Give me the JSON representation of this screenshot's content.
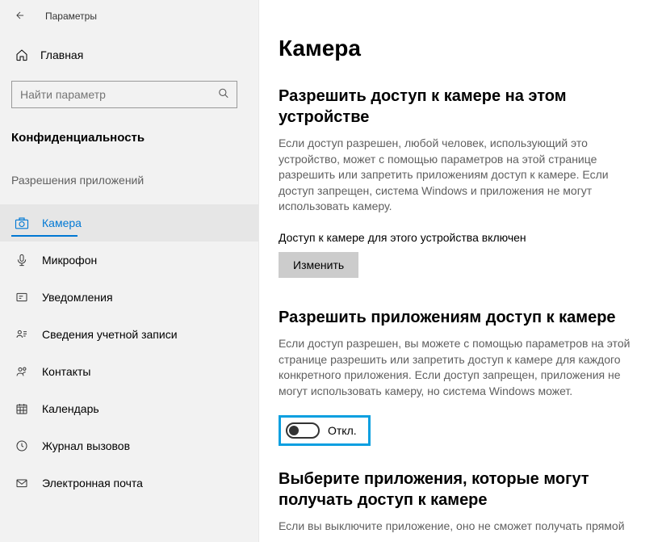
{
  "titlebar": {
    "label": "Параметры"
  },
  "home": {
    "label": "Главная"
  },
  "search": {
    "placeholder": "Найти параметр"
  },
  "group": {
    "title": "Конфиденциальность"
  },
  "subgroup": {
    "title": "Разрешения приложений"
  },
  "nav": {
    "items": [
      {
        "label": "Камера"
      },
      {
        "label": "Микрофон"
      },
      {
        "label": "Уведомления"
      },
      {
        "label": "Сведения учетной записи"
      },
      {
        "label": "Контакты"
      },
      {
        "label": "Календарь"
      },
      {
        "label": "Журнал вызовов"
      },
      {
        "label": "Электронная почта"
      }
    ]
  },
  "page": {
    "title": "Камера"
  },
  "section1": {
    "title": "Разрешить доступ к камере на этом устройстве",
    "desc": "Если доступ разрешен, любой человек, использующий это устройство, может с помощью параметров на этой странице разрешить или запретить приложениям доступ к камере. Если доступ запрещен, система Windows и приложения не могут использовать камеру.",
    "status": "Доступ к камере для этого устройства включен",
    "button": "Изменить"
  },
  "section2": {
    "title": "Разрешить приложениям доступ к камере",
    "desc": "Если доступ разрешен, вы можете с помощью параметров на этой странице разрешить или запретить доступ к камере для каждого конкретного приложения. Если доступ запрещен, приложения не могут использовать камеру, но система Windows может.",
    "toggle_label": "Откл."
  },
  "section3": {
    "title": "Выберите приложения, которые могут получать доступ к камере",
    "desc": "Если вы выключите приложение, оно не сможет получать прямой"
  }
}
